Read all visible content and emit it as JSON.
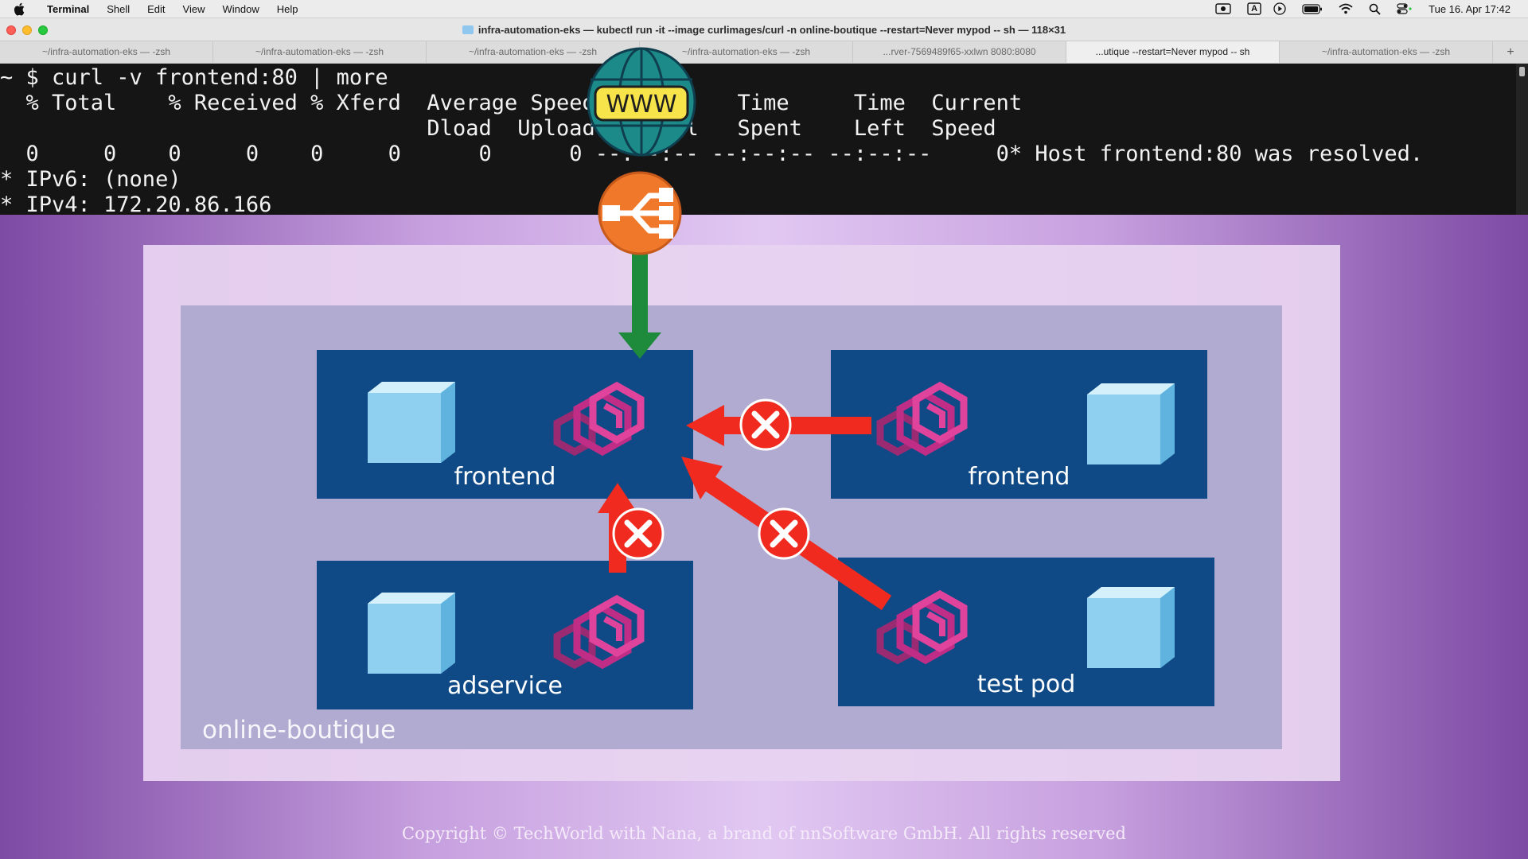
{
  "menubar": {
    "app_name": "Terminal",
    "items": [
      "Shell",
      "Edit",
      "View",
      "Window",
      "Help"
    ],
    "clock": "Tue 16. Apr  17:42",
    "input_source": "A"
  },
  "window": {
    "title": "infra-automation-eks — kubectl run -it --image curlimages/curl -n online-boutique --restart=Never mypod -- sh — 118×31"
  },
  "tabs": [
    "~/infra-automation-eks — -zsh",
    "~/infra-automation-eks — -zsh",
    "~/infra-automation-eks — -zsh",
    "~/infra-automation-eks — -zsh",
    "...rver-7569489f65-xxlwn 8080:8080",
    "...utique --restart=Never mypod -- sh",
    "~/infra-automation-eks — -zsh"
  ],
  "terminal": {
    "lines": [
      "~ $ curl -v frontend:80 | more",
      "  % Total    % Received % Xferd  Average Speed   Time    Time     Time  Current",
      "                                 Dload  Upload   Total   Spent    Left  Speed",
      "  0     0    0     0    0     0      0      0 --:--:-- --:--:-- --:--:--     0* Host frontend:80 was resolved.",
      "* IPv6: (none)",
      "* IPv4: 172.20.86.166"
    ]
  },
  "diagram": {
    "www_label": "WWW",
    "namespace_label": "online-boutique",
    "pods": [
      {
        "id": "frontend-a",
        "label": "frontend"
      },
      {
        "id": "frontend-b",
        "label": "frontend"
      },
      {
        "id": "adservice",
        "label": "adservice"
      },
      {
        "id": "test-pod",
        "label": "test pod"
      }
    ],
    "copyright": "Copyright © TechWorld with Nana, a brand of nnSoftware GmbH. All rights reserved",
    "colors": {
      "pod_background": "#0f4a86",
      "namespace_box": "#b1abd1",
      "allowed_arrow": "#1e8a3c",
      "blocked_arrow": "#f02a1e",
      "load_balancer": "#f0782a",
      "k8s_icon": "#d2338f",
      "container_cube": "#8fd3f5"
    },
    "connections": [
      {
        "from": "internet",
        "to": "frontend-a",
        "allowed": true
      },
      {
        "from": "frontend-b",
        "to": "frontend-a",
        "allowed": false
      },
      {
        "from": "adservice",
        "to": "frontend-a",
        "allowed": false
      },
      {
        "from": "test-pod",
        "to": "frontend-a",
        "allowed": false
      }
    ]
  }
}
